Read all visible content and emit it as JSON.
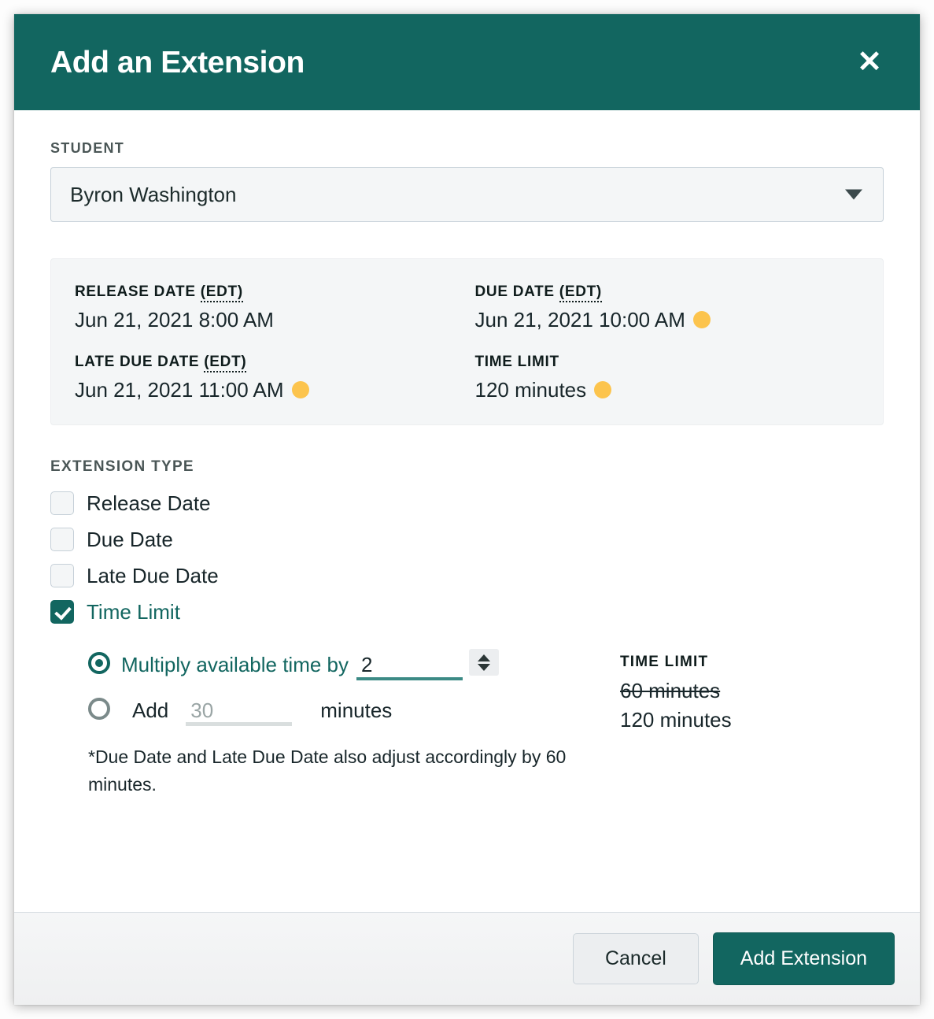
{
  "modal": {
    "title": "Add an Extension",
    "close_icon": "close-icon"
  },
  "student": {
    "label": "STUDENT",
    "selected": "Byron Washington",
    "caret_icon": "chevron-down-icon"
  },
  "info_panel": {
    "release_date": {
      "label_main": "RELEASE DATE ",
      "label_abbr": "(EDT)",
      "value": "Jun 21, 2021 8:00 AM",
      "has_dot": false
    },
    "due_date": {
      "label_main": "DUE DATE ",
      "label_abbr": "(EDT)",
      "value": "Jun 21, 2021 10:00 AM",
      "has_dot": true
    },
    "late_due_date": {
      "label_main": "LATE DUE DATE ",
      "label_abbr": "(EDT)",
      "value": "Jun 21, 2021 11:00 AM",
      "has_dot": true
    },
    "time_limit": {
      "label_main": "TIME LIMIT",
      "label_abbr": "",
      "value": "120 minutes",
      "has_dot": true
    }
  },
  "extension_type": {
    "heading": "EXTENSION TYPE",
    "options": [
      {
        "label": "Release Date",
        "checked": false
      },
      {
        "label": "Due Date",
        "checked": false
      },
      {
        "label": "Late Due Date",
        "checked": false
      },
      {
        "label": "Time Limit",
        "checked": true
      }
    ]
  },
  "time_limit_options": {
    "multiply": {
      "label": "Multiply available time by",
      "selected": true,
      "value": "2",
      "spinner_up_icon": "caret-up-icon",
      "spinner_down_icon": "caret-down-icon"
    },
    "add": {
      "label": "Add",
      "selected": false,
      "placeholder": "30",
      "unit": "minutes"
    },
    "note": "*Due Date and Late Due Date also adjust accordingly by 60 minutes."
  },
  "preview": {
    "heading": "TIME LIMIT",
    "old_value": "60 minutes",
    "new_value": "120 minutes"
  },
  "footer": {
    "cancel_label": "Cancel",
    "submit_label": "Add Extension"
  },
  "colors": {
    "brand_teal": "#126660",
    "accent_yellow": "#fcc44d",
    "panel_grey": "#f4f6f7",
    "text_dark": "#18262a"
  }
}
